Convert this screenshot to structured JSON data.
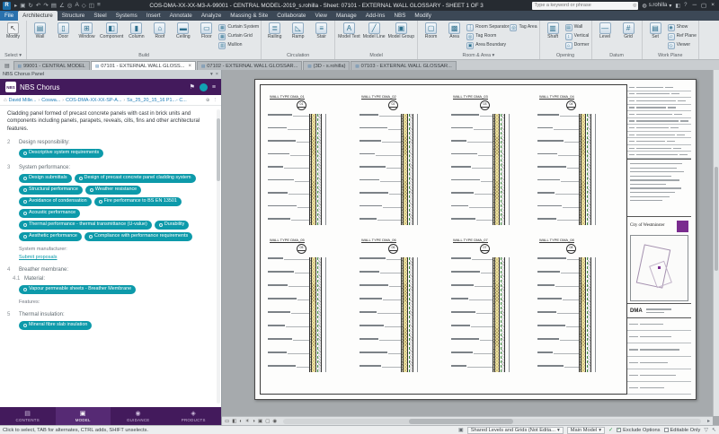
{
  "window": {
    "title": "COS-DMA-XX-XX-M3-A-99001 - CENTRAL MODEL-2019_s.rohilla - Sheet: 07101 - EXTERNAL WALL GLOSSARY - SHEET 1 OF 3",
    "search_placeholder": "Type a keyword or phrase",
    "user": "s.rohilla"
  },
  "ribbon": {
    "tabs": [
      "File",
      "Architecture",
      "Structure",
      "Steel",
      "Systems",
      "Insert",
      "Annotate",
      "Analyze",
      "Massing & Site",
      "Collaborate",
      "View",
      "Manage",
      "Add-Ins",
      "NBS",
      "Modify"
    ],
    "active_tab": "Architecture",
    "modify_label": "Modify",
    "select_label": "Select ▾",
    "groups": [
      {
        "label": "Build",
        "big": [
          "Wall",
          "Door",
          "Window",
          "Component",
          "Column",
          "Roof",
          "Ceiling",
          "Floor"
        ],
        "small": [
          "Curtain System",
          "Curtain Grid",
          "Mullion"
        ]
      },
      {
        "label": "Circulation",
        "big": [
          "Railing",
          "Ramp",
          "Stair"
        ],
        "small": []
      },
      {
        "label": "Model",
        "big": [
          "Model Text",
          "Model Line",
          "Model Group"
        ],
        "small": []
      },
      {
        "label": "Room & Area ▾",
        "big": [
          "Room",
          "Area"
        ],
        "small": [
          "Room Separator",
          "Tag Room",
          "Area Boundary",
          "Tag Area"
        ]
      },
      {
        "label": "Opening",
        "big": [
          "Shaft"
        ],
        "small": [
          "Wall",
          "Vertical",
          "Dormer"
        ]
      },
      {
        "label": "Datum",
        "big": [
          "Level",
          "Grid"
        ],
        "small": []
      },
      {
        "label": "Work Plane",
        "big": [
          "Set"
        ],
        "small": [
          "Show",
          "Ref Plane",
          "Viewer"
        ]
      }
    ]
  },
  "view_tabs": [
    {
      "label": "99001 - CENTRAL MODEL",
      "active": false
    },
    {
      "label": "07101 - EXTERNAL WALL GLOSS...",
      "active": true
    },
    {
      "label": "07102 - EXTERNAL WALL GLOSSAR...",
      "active": false
    },
    {
      "label": "{3D - s.rohilla}",
      "active": false
    },
    {
      "label": "07103 - EXTERNAL WALL GLOSSAR...",
      "active": false
    }
  ],
  "nbs": {
    "dock_title": "NBS Chorus Panel",
    "brand": "NBS Chorus",
    "breadcrumb": [
      "David Mille...",
      "Coswa...",
      "COS-DMA-XX-XX-SP-A...",
      "Ss_25_20_15_16 P1...- C..."
    ],
    "description": "Cladding panel formed of precast concrete panels with cast in brick units and components including panels, parapets, reveals, cills, fins and other architectural features.",
    "sections": [
      {
        "num": "2",
        "title": "Design responsibility:",
        "pills": [
          "Descriptive system requirements"
        ]
      },
      {
        "num": "3",
        "title": "System performance:",
        "pills": [
          "Design submittals",
          "Design of precast concrete panel cladding system",
          "Structural performance",
          "Weather resistance",
          "Avoidance of condensation",
          "Fire performance to BS EN 13501",
          "Acoustic performance",
          "Thermal performance - thermal transmittance (U-value)",
          "Durability",
          "Aesthetic performance",
          "Compliance with performance requirements"
        ],
        "note": "System manufacturer:",
        "note_link": "Submit proposals"
      },
      {
        "num": "4",
        "title": "Breather membrane:",
        "subnum": "4.1",
        "subtitle": "Material:",
        "pills": [
          "Vapour permeable sheets - Breather Membrane"
        ],
        "note": "Features:"
      },
      {
        "num": "5",
        "title": "Thermal insulation:",
        "pills": [
          "Mineral fibre slab insulation"
        ]
      }
    ],
    "tabs": [
      "CONTENTS",
      "MODEL",
      "GUIDANCE",
      "PRODUCTS"
    ],
    "active_tab": "MODEL"
  },
  "sheet": {
    "details": [
      {
        "title": "WALL TYPE DMA_01",
        "bubble": "01"
      },
      {
        "title": "WALL TYPE DMA_02",
        "bubble": "02"
      },
      {
        "title": "WALL TYPE DMA_03",
        "bubble": "03"
      },
      {
        "title": "WALL TYPE DMA_04",
        "bubble": "04"
      },
      {
        "title": "WALL TYPE DMA_05",
        "bubble": "05"
      },
      {
        "title": "WALL TYPE DMA_06",
        "bubble": "06"
      },
      {
        "title": "WALL TYPE DMA_07",
        "bubble": "07"
      },
      {
        "title": "WALL TYPE DMA_08",
        "bubble": "08"
      }
    ],
    "title_block": {
      "client": "City of Westminster",
      "firm": "DMA"
    }
  },
  "status": {
    "hint": "Click to select, TAB for alternates, CTRL adds, SHIFT unselects.",
    "workset": "Shared Levels and Grids (Not Edita...",
    "design_option": "Main Model",
    "exclude_options": "Exclude Options",
    "editable_only": "Editable Only"
  },
  "colors": {
    "nbs_purple": "#431a5c",
    "nbs_teal": "#0d9aaa",
    "westminster_purple": "#7a2c8f"
  }
}
